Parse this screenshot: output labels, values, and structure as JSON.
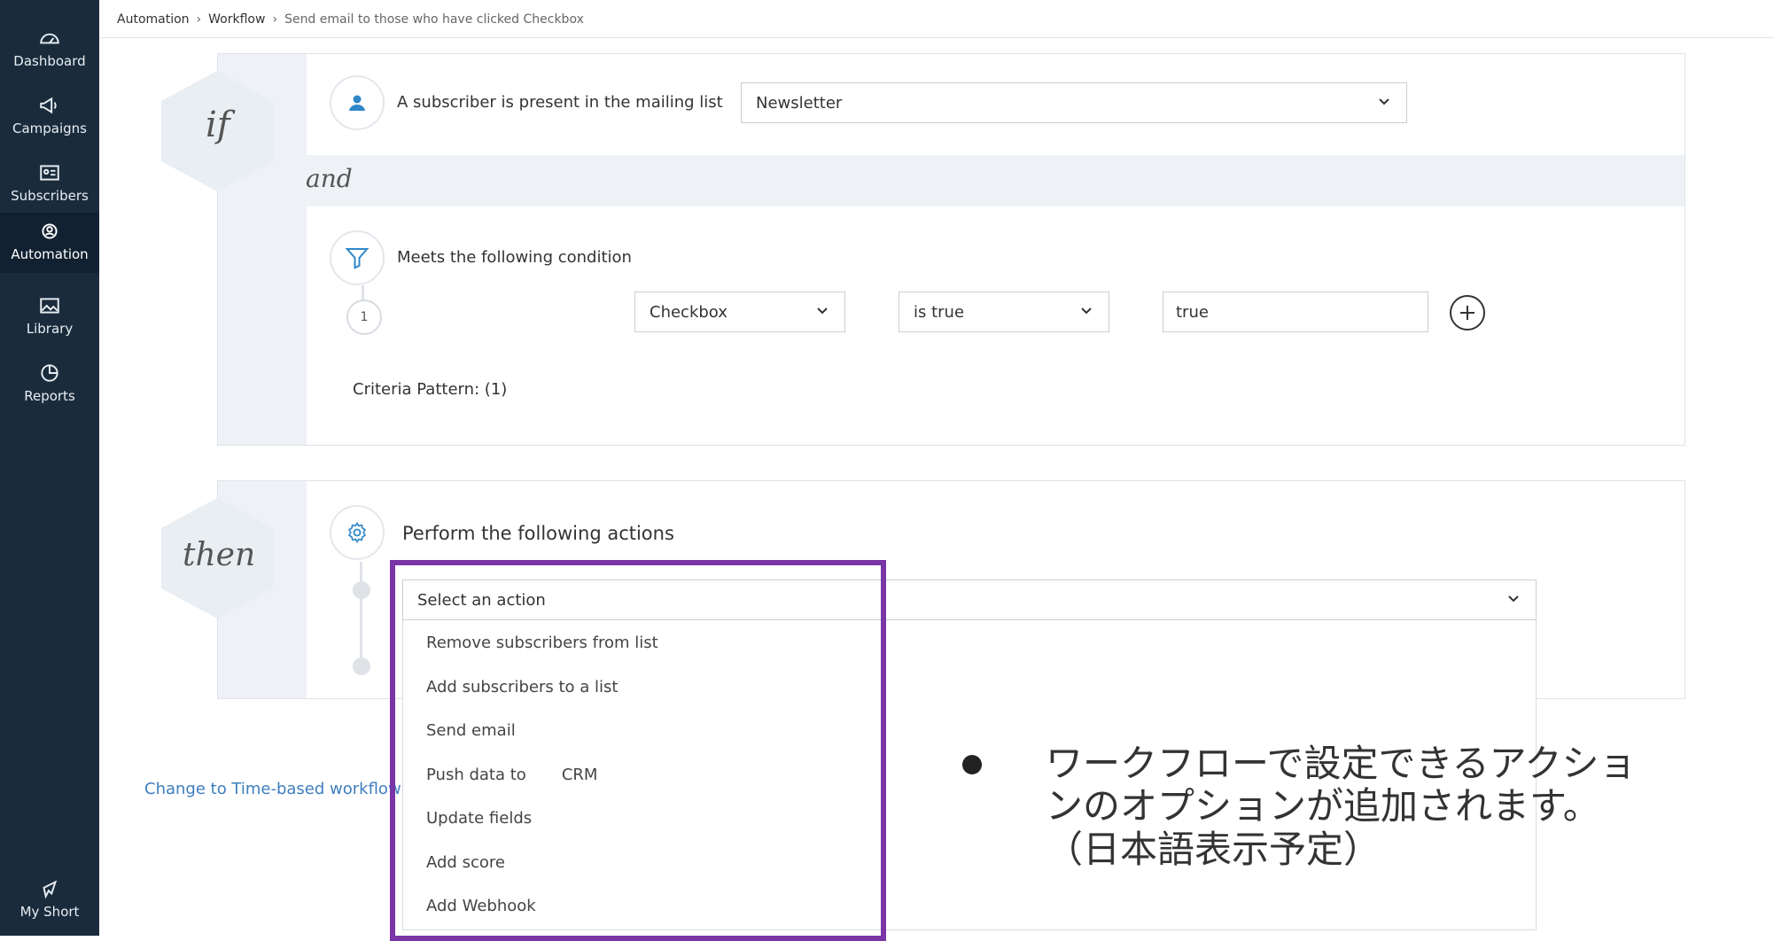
{
  "sidebar": {
    "items": [
      {
        "label": "Dashboard",
        "icon": "dashboard-icon"
      },
      {
        "label": "Campaigns",
        "icon": "megaphone-icon"
      },
      {
        "label": "Subscribers",
        "icon": "contact-card-icon"
      },
      {
        "label": "Automation",
        "icon": "automation-icon",
        "active": true
      },
      {
        "label": "Library",
        "icon": "image-icon"
      },
      {
        "label": "Reports",
        "icon": "pie-chart-icon"
      }
    ],
    "bottom": {
      "label": "My Short",
      "icon": "shortcut-icon"
    }
  },
  "breadcrumb": {
    "items": [
      "Automation",
      "Workflow",
      "Send email to those who have clicked Checkbox"
    ],
    "separator": "›"
  },
  "if_block": {
    "keyword": "if",
    "trigger_label": "A subscriber is present in the mailing list",
    "list_select": {
      "value": "Newsletter"
    },
    "joiner": "and",
    "condition_label": "Meets the following condition",
    "condition": {
      "number": "1",
      "field": "Checkbox",
      "operator": "is true",
      "value": "true"
    },
    "criteria_pattern": "Criteria Pattern: (1)"
  },
  "then_block": {
    "keyword": "then",
    "actions_label": "Perform the following actions",
    "action_select": {
      "placeholder": "Select an action"
    },
    "options": [
      "Remove subscribers from list",
      "Add subscribers to a list",
      "Send email",
      "Push data to       CRM",
      "Update fields",
      "Add score",
      "Add Webhook"
    ]
  },
  "change_link": "Change to Time-based workflow",
  "annotation": {
    "lines": [
      "ワークフローで設定できるアクショ",
      "ンのオプションが追加されます。",
      "（日本語表示予定）"
    ]
  },
  "colors": {
    "sidebar": "#1a2b3c",
    "highlight": "#7a35a6",
    "link": "#3d7ebf",
    "accent_icon": "#2f87c7"
  }
}
